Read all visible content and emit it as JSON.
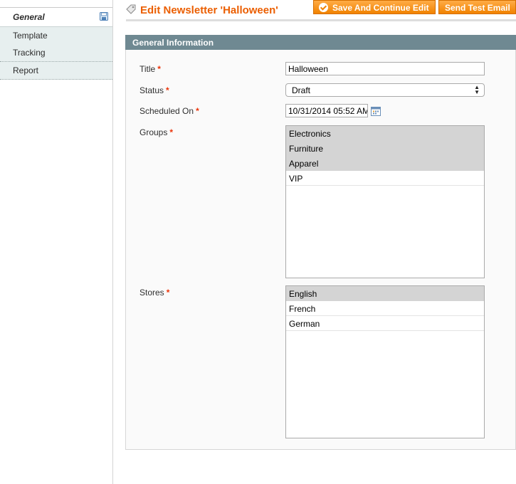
{
  "sidebar": {
    "tabs": [
      {
        "label": "General",
        "active": true
      },
      {
        "label": "Template",
        "active": false
      },
      {
        "label": "Tracking",
        "active": false
      },
      {
        "label": "Report",
        "active": false
      }
    ]
  },
  "header": {
    "title": "Edit Newsletter 'Halloween'",
    "buttons": {
      "save_continue": "Save And Continue Edit",
      "send_test": "Send Test Email"
    }
  },
  "section": {
    "title": "General Information"
  },
  "form": {
    "title_label": "Title",
    "title_value": "Halloween",
    "status_label": "Status",
    "status_value": "Draft",
    "scheduled_label": "Scheduled On",
    "scheduled_value": "10/31/2014 05:52 AM",
    "groups_label": "Groups",
    "groups": [
      {
        "label": "Electronics",
        "selected": true
      },
      {
        "label": "Furniture",
        "selected": true
      },
      {
        "label": "Apparel",
        "selected": true
      },
      {
        "label": "VIP",
        "selected": false
      }
    ],
    "stores_label": "Stores",
    "stores": [
      {
        "label": "English",
        "selected": true
      },
      {
        "label": "French",
        "selected": false
      },
      {
        "label": "German",
        "selected": false
      }
    ],
    "required_marker": "*"
  },
  "colors": {
    "accent": "#eb5e00",
    "button_bg": "#f18200",
    "section_header": "#6f8992",
    "required": "#eb340a"
  },
  "icons": {
    "title_icon": "tag-icon",
    "tab_icon": "save-icon",
    "date_icon": "calendar-icon",
    "button_icon": "checkmark-circle-icon"
  }
}
